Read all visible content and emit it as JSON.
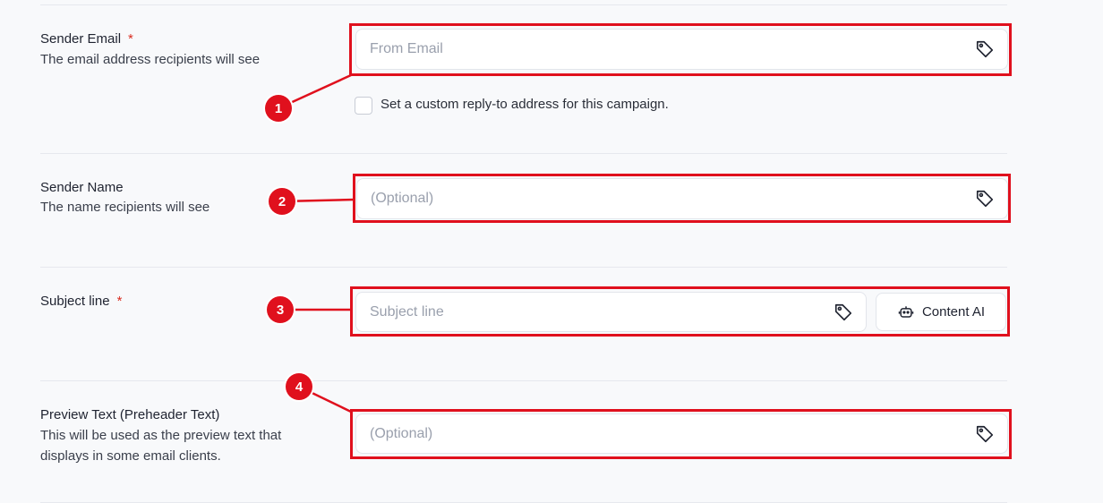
{
  "sender_email": {
    "title": "Sender Email",
    "required_mark": "*",
    "description": "The email address recipients will see",
    "placeholder": "From Email",
    "reply_to_label": "Set a custom reply-to address for this campaign.",
    "badge": "1"
  },
  "sender_name": {
    "title": "Sender Name",
    "description": "The name recipients will see",
    "placeholder": "(Optional)",
    "badge": "2"
  },
  "subject_line": {
    "title": "Subject line",
    "required_mark": "*",
    "placeholder": "Subject line",
    "content_ai_label": "Content AI",
    "badge": "3"
  },
  "preview_text": {
    "title": "Preview Text (Preheader Text)",
    "description": "This will be used as the preview text that displays in some email clients.",
    "placeholder": "(Optional)",
    "badge": "4"
  },
  "colors": {
    "annotation_red": "#e0101d",
    "required_red": "#d92d20"
  },
  "icons": {
    "tag": "tag-icon",
    "robot": "robot-icon"
  }
}
